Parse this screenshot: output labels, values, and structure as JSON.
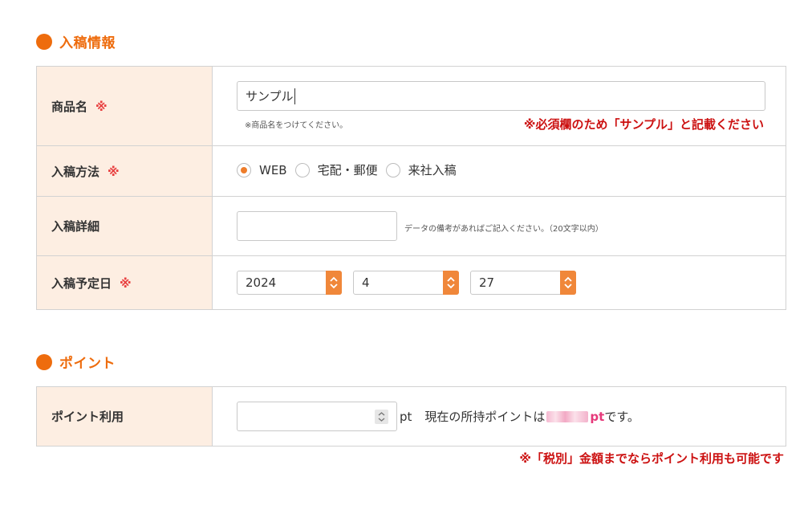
{
  "sections": {
    "submission": {
      "title": "入稿情報"
    },
    "points": {
      "title": "ポイント"
    }
  },
  "required_mark": "※",
  "product": {
    "label": "商品名",
    "value": "サンプル",
    "hint": "※商品名をつけてください。",
    "red_note": "※必須欄のため「サンプル」と記載ください"
  },
  "method": {
    "label": "入稿方法",
    "options": [
      {
        "label": "WEB",
        "selected": true
      },
      {
        "label": "宅配・郵便",
        "selected": false
      },
      {
        "label": "来社入稿",
        "selected": false
      }
    ]
  },
  "detail": {
    "label": "入稿詳細",
    "value": "",
    "hint": "データの備考があればご記入ください。（20文字以内）"
  },
  "date": {
    "label": "入稿予定日",
    "year": "2024",
    "month": "4",
    "day": "27"
  },
  "point_use": {
    "label": "ポイント利用",
    "value": "",
    "unit": "pt",
    "current_prefix": "現在の所持ポイントは",
    "current_unit": "pt",
    "current_suffix": "です。",
    "red_note": "※「税別」金額までならポイント利用も可能です"
  },
  "colors": {
    "accent": "#ee6c0d",
    "label_bg": "#fdeee2",
    "required": "#e84040",
    "note_red": "#cc1111"
  }
}
